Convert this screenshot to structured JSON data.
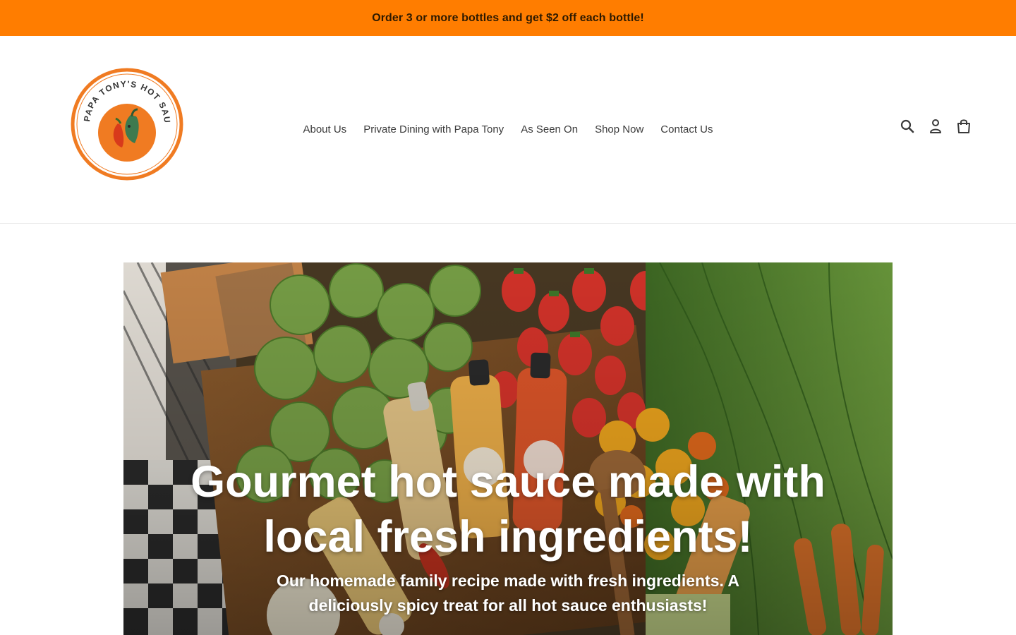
{
  "announcement": {
    "text": "Order 3 or more bottles and get $2 off each bottle!"
  },
  "logo": {
    "name": "PAPA TONY'S HOT SAUCE",
    "ring_color": "#f07b22",
    "icon": "pepper-icon"
  },
  "nav": {
    "items": [
      {
        "label": "About Us"
      },
      {
        "label": "Private Dining with Papa Tony"
      },
      {
        "label": "As Seen On"
      },
      {
        "label": "Shop Now"
      },
      {
        "label": "Contact Us"
      }
    ]
  },
  "header_icons": [
    "search-icon",
    "account-icon",
    "cart-icon"
  ],
  "hero": {
    "title": "Gourmet hot sauce made with local fresh ingredients!",
    "subtitle": "Our homemade family recipe made with fresh ingredients. A deliciously spicy treat for all hot sauce enthusiasts!"
  },
  "colors": {
    "announcement_bg": "#ff7d00",
    "nav_text": "#3a3a3a",
    "hero_text": "#ffffff"
  }
}
